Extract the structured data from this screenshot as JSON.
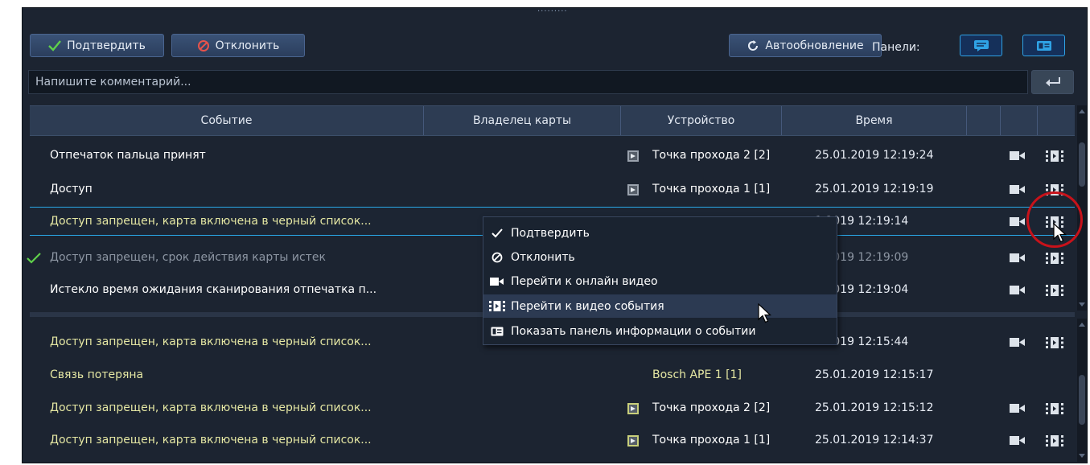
{
  "grip": "·········",
  "toolbar": {
    "confirm_label": "Подтвердить",
    "reject_label": "Отклонить",
    "autoupdate_label": "Автообновление",
    "panels_label": "Панели:"
  },
  "comment": {
    "placeholder": "Напишите комментарий..."
  },
  "table": {
    "columns": [
      "Событие",
      "Владелец карты",
      "Устройство",
      "Время"
    ],
    "rows": [
      {
        "event": "Отпечаток пальца принят",
        "device": "Точка прохода 2 [2]",
        "time": "25.01.2019 12:19:24"
      },
      {
        "event": "Доступ",
        "device": "Точка прохода 1 [1]",
        "time": "25.01.2019 12:19:19"
      },
      {
        "event": "Доступ запрещен, карта включена в черный список...",
        "device": "",
        "time": "1.2019 12:19:14"
      },
      {
        "event": "Доступ запрещен, срок действия карты истек",
        "device": "",
        "time": "1.2019 12:19:09"
      },
      {
        "event": "Истекло время ожидания сканирования отпечатка п...",
        "device": "",
        "time": "1.2019 12:19:04"
      },
      {
        "event": "Доступ запрещен, карта включена в черный список...",
        "device": "",
        "time": "1.2019 12:15:44"
      },
      {
        "event": "Связь потеряна",
        "device": "Bosch APE 1 [1]",
        "time": "25.01.2019 12:15:17"
      },
      {
        "event": "Доступ запрещен, карта включена в черный список...",
        "device": "Точка прохода 2 [2]",
        "time": "25.01.2019 12:15:12"
      },
      {
        "event": "Доступ запрещен, карта включена в черный список...",
        "device": "Точка прохода 1 [1]",
        "time": "25.01.2019 12:14:37"
      }
    ]
  },
  "context_menu": {
    "items": [
      {
        "label": "Подтвердить",
        "icon": "check-icon"
      },
      {
        "label": "Отклонить",
        "icon": "reject-icon"
      },
      {
        "label": "Перейти к онлайн видео",
        "icon": "camera-icon"
      },
      {
        "label": "Перейти к видео события",
        "icon": "film-icon"
      },
      {
        "label": "Показать панель информации о событии",
        "icon": "info-card-icon"
      }
    ]
  },
  "colors": {
    "background": "#1c2431",
    "header": "#2d3c53",
    "accent": "#2aa8e8",
    "confirm_green": "#5fd04a",
    "reject_red": "#e8534a",
    "event_yellow": "#e5e7a3",
    "highlight_circle": "#c8121a"
  }
}
